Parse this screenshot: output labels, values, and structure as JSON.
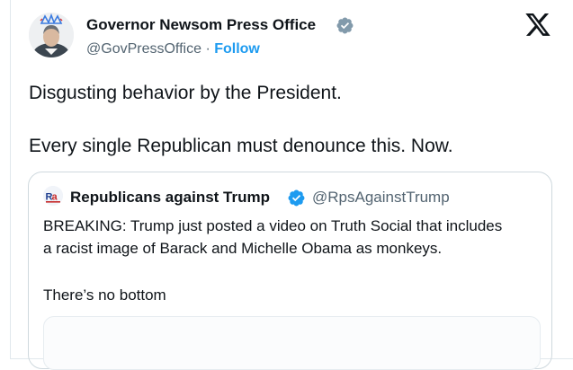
{
  "author": {
    "name": "Governor Newsom Press Office",
    "handle": "@GovPressOffice",
    "separator": "·",
    "follow_label": "Follow",
    "verified": true,
    "avatar_icon": "avatar-portrait-with-crown"
  },
  "platform": {
    "logo_icon": "x-logo-icon"
  },
  "tweet": {
    "lines": [
      "Disgusting behavior by the President.",
      "Every single Republican must denounce this. Now."
    ]
  },
  "quoted_tweet": {
    "author_name": "Republicans against Trump",
    "handle": "@RpsAgainstTrump",
    "verified": true,
    "avatar_icon": "rat-logo-icon",
    "lines": [
      "BREAKING: Trump just posted a video on Truth Social that includes",
      "a racist image of Barack and Michelle Obama as monkeys.",
      "There’s no bottom"
    ]
  },
  "colors": {
    "accent": "#1d9bf0",
    "secondary_text": "#536471",
    "verified_main": "#829aab",
    "verified_quote": "#1d9bf0",
    "border": "#cfd9de"
  }
}
